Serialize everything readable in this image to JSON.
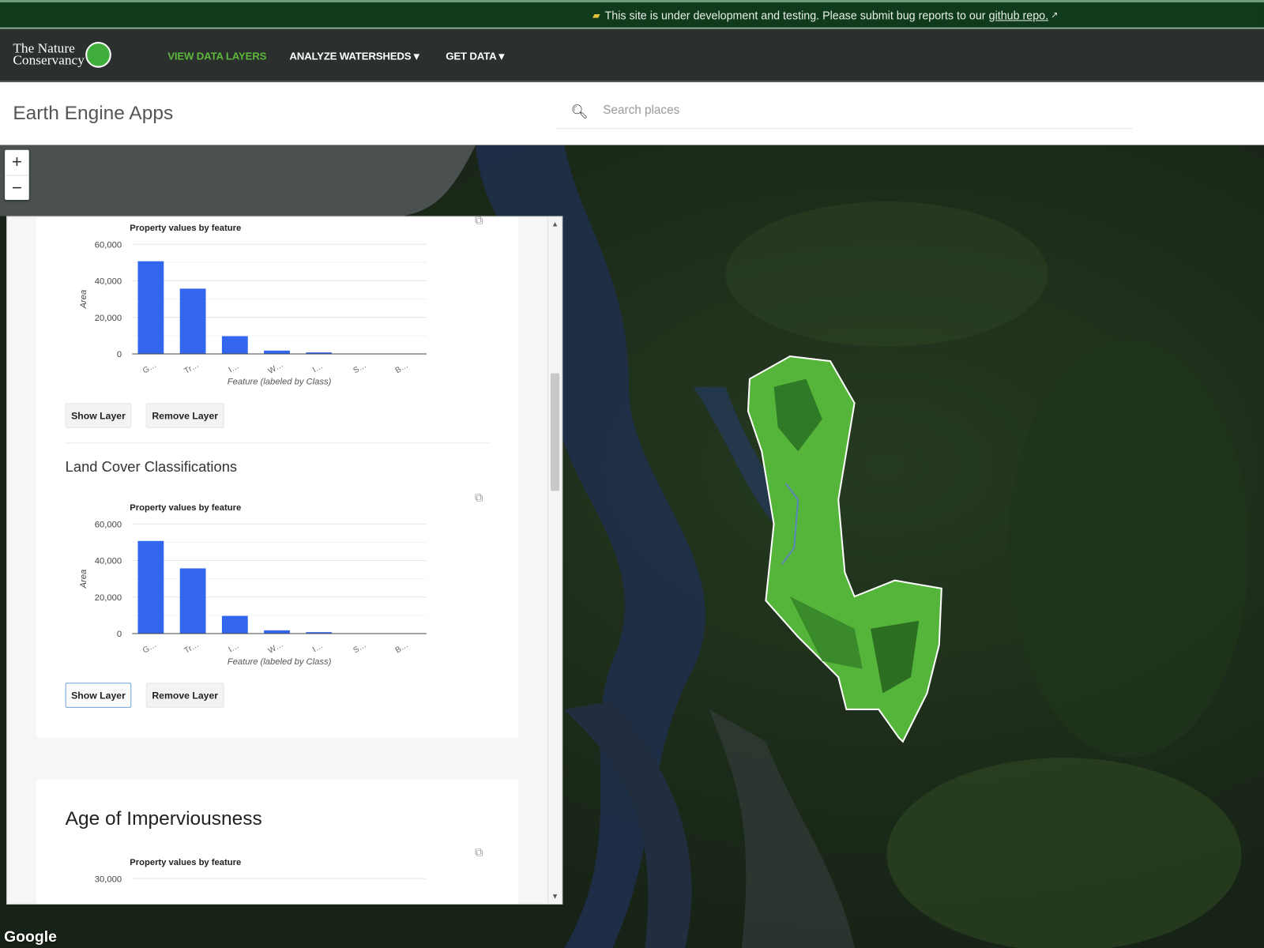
{
  "banner": {
    "icon": "construction-flag-icon",
    "text": "This site is under development and testing. Please submit bug reports to our",
    "link": "github repo.",
    "link_icon": "external-link-icon"
  },
  "nav": {
    "logo_line1": "The Nature",
    "logo_line2": "Conservancy",
    "items": [
      {
        "label": "VIEW DATA LAYERS",
        "active": true
      },
      {
        "label": "ANALYZE WATERSHEDS ▾"
      },
      {
        "label": "GET DATA ▾"
      }
    ],
    "accent": "#5cb83a"
  },
  "header": {
    "title": "Earth Engine Apps",
    "search_placeholder": "Search places",
    "search_value": ""
  },
  "map": {
    "zoom_in": "+",
    "zoom_out": "−",
    "attribution": "Google"
  },
  "panel": {
    "card1": {
      "show_label": "Show Layer",
      "remove_label": "Remove Layer"
    },
    "card2": {
      "title": "Land Cover Classifications",
      "show_label": "Show Layer",
      "remove_label": "Remove Layer"
    },
    "card3": {
      "title": "Age of Imperviousness"
    }
  },
  "chart_data": [
    {
      "type": "bar",
      "title": "Property values by feature",
      "xlabel": "Feature (labeled by Class)",
      "ylabel": "Area",
      "ylim": [
        0,
        60000
      ],
      "yticks": [
        "60,000",
        "40,000",
        "20,000",
        "0"
      ],
      "categories": [
        "G…",
        "Tr…",
        "I…",
        "W…",
        "I…",
        "S…",
        "B…"
      ],
      "values": [
        50700,
        35700,
        9700,
        1800,
        800,
        200,
        100
      ],
      "color": "#3366ee",
      "grid": true
    },
    {
      "type": "bar",
      "title": "Property values by feature",
      "xlabel": "Feature (labeled by Class)",
      "ylabel": "Area",
      "ylim": [
        0,
        60000
      ],
      "yticks": [
        "60,000",
        "40,000",
        "20,000",
        "0"
      ],
      "categories": [
        "G…",
        "Tr…",
        "I…",
        "W…",
        "I…",
        "S…",
        "B…"
      ],
      "values": [
        50700,
        35700,
        9700,
        1800,
        800,
        200,
        100
      ],
      "color": "#3366ee",
      "grid": true
    },
    {
      "type": "bar",
      "title": "Property values by feature",
      "yticks": [
        "30,000"
      ]
    }
  ]
}
